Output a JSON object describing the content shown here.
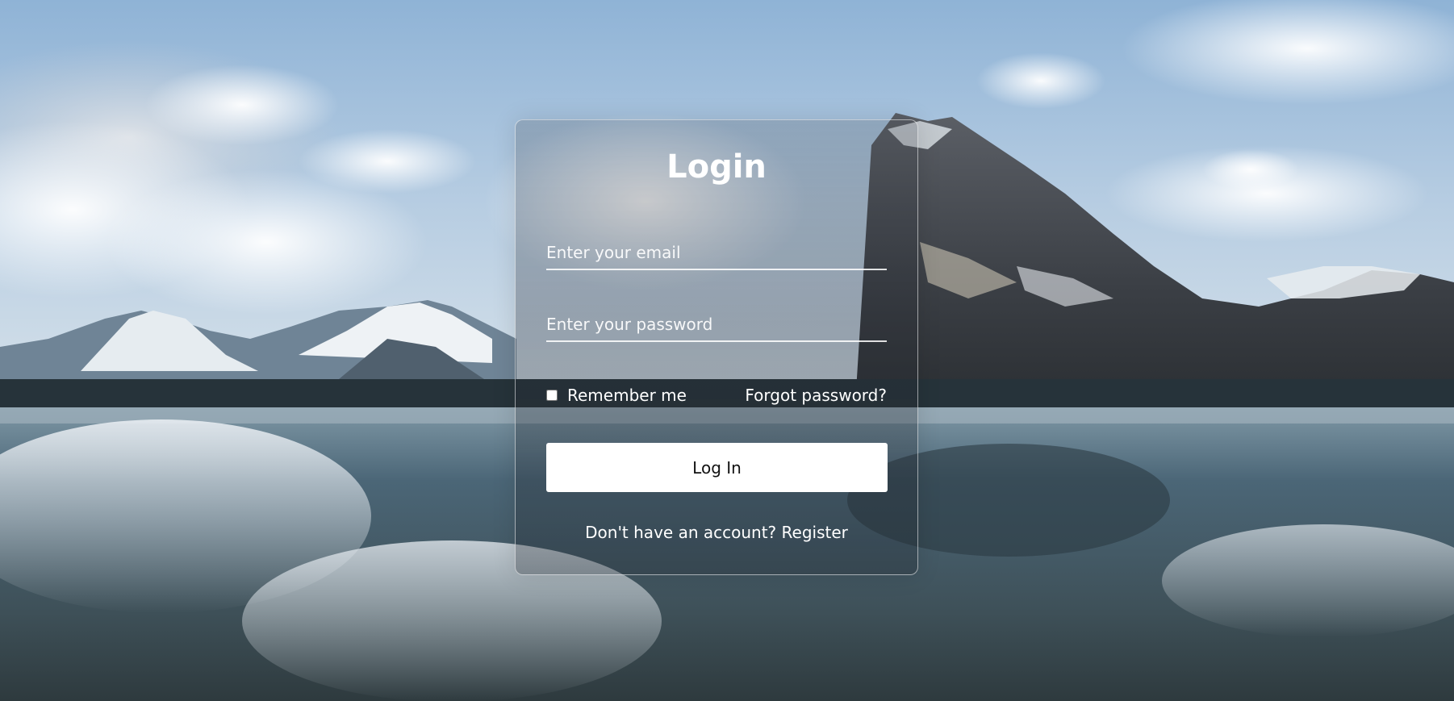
{
  "background": {
    "sky_color": "#9fbfdc",
    "water_color": "#4a6a7a"
  },
  "login": {
    "title": "Login",
    "email_placeholder": "Enter your email",
    "password_placeholder": "Enter your password",
    "remember_label": "Remember me",
    "forgot_label": "Forgot password?",
    "submit_label": "Log In",
    "register_prompt": "Don't have an account?",
    "register_link": "Register"
  }
}
